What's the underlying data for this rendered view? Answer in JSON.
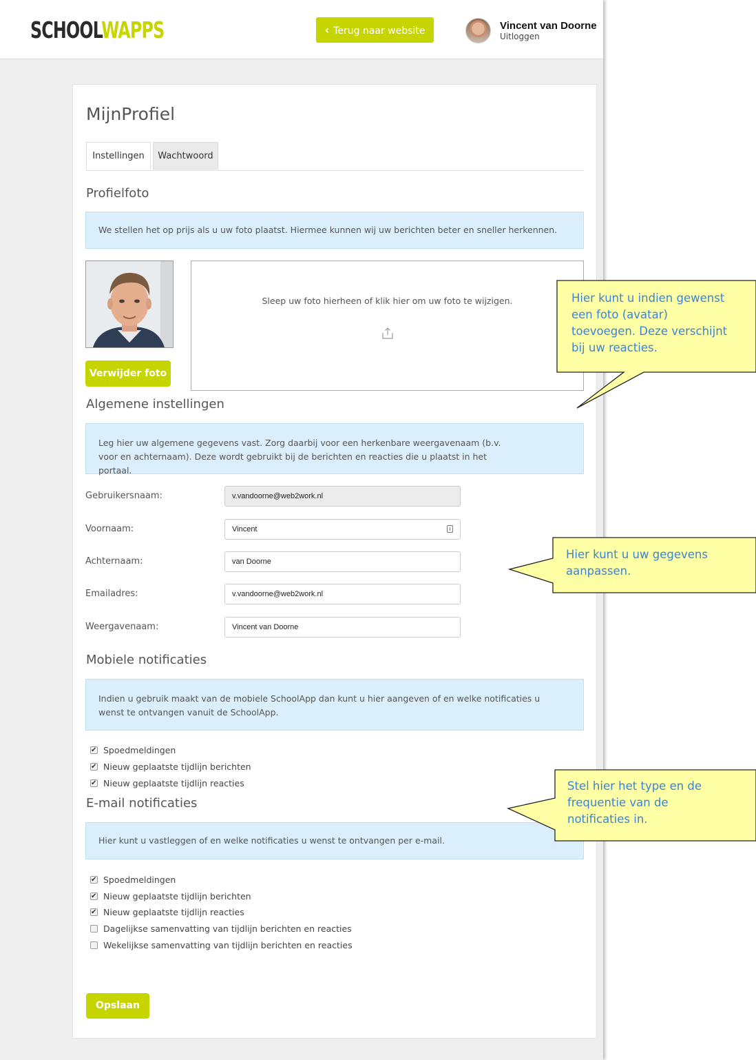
{
  "header": {
    "logo_part1": "SCHOOL",
    "logo_part2": "WAPPS",
    "back_button": "Terug naar website",
    "user_name": "Vincent van Doorne",
    "logout": "Uitloggen"
  },
  "page": {
    "title": "MijnProfiel",
    "tabs": [
      {
        "label": "Instellingen",
        "active": true
      },
      {
        "label": "Wachtwoord",
        "active": false
      }
    ]
  },
  "profile_photo": {
    "title": "Profielfoto",
    "info": "We stellen het op prijs als u uw foto plaatst. Hiermee kunnen wij uw berichten beter en sneller herkennen.",
    "drop_text": "Sleep uw foto hierheen of klik hier om uw foto te wijzigen.",
    "delete_button": "Verwijder foto"
  },
  "general": {
    "title": "Algemene instellingen",
    "info": "Leg hier uw algemene gegevens vast. Zorg daarbij voor een herkenbare weergavenaam (b.v. voor en achternaam). Deze wordt gebruikt bij de berichten en reacties die u plaatst in het portaal.",
    "fields": [
      {
        "label": "Gebruikersnaam:",
        "value": "v.vandoorne@web2work.nl",
        "disabled": true
      },
      {
        "label": "Voornaam:",
        "value": "Vincent"
      },
      {
        "label": "Achternaam:",
        "value": "van Doorne"
      },
      {
        "label": "Emailadres:",
        "value": "v.vandoorne@web2work.nl"
      },
      {
        "label": "Weergavenaam:",
        "value": "Vincent van Doorne"
      }
    ]
  },
  "mobile": {
    "title": "Mobiele notificaties",
    "info": "Indien u gebruik maakt van de mobiele SchoolApp dan kunt u hier aangeven of en welke notificaties u wenst te ontvangen vanuit de SchoolApp.",
    "options": [
      {
        "label": "Spoedmeldingen",
        "checked": true
      },
      {
        "label": "Nieuw geplaatste tijdlijn berichten",
        "checked": true
      },
      {
        "label": "Nieuw geplaatste tijdlijn reacties",
        "checked": true
      }
    ]
  },
  "email": {
    "title": "E-mail notificaties",
    "info": "Hier kunt u vastleggen of en welke notificaties u wenst te ontvangen per e-mail.",
    "options": [
      {
        "label": "Spoedmeldingen",
        "checked": true
      },
      {
        "label": "Nieuw geplaatste tijdlijn berichten",
        "checked": true
      },
      {
        "label": "Nieuw geplaatste tijdlijn reacties",
        "checked": true
      },
      {
        "label": "Dagelijkse samenvatting van tijdlijn berichten en reacties",
        "checked": false
      },
      {
        "label": "Wekelijkse samenvatting van tijdlijn berichten en reacties",
        "checked": false
      }
    ]
  },
  "save_button": "Opslaan",
  "callouts": [
    {
      "lines": [
        "Hier kunt u indien gewenst",
        "een foto (avatar)",
        "toevoegen. Deze verschijnt",
        "bij uw reacties."
      ]
    },
    {
      "lines": [
        "Hier kunt u uw gegevens",
        "aanpassen."
      ]
    },
    {
      "lines": [
        "Stel hier het type en de",
        "frequentie van de",
        "notificaties in."
      ]
    }
  ],
  "colors": {
    "accent": "#c6d400",
    "info_bg": "#dbeefc",
    "callout_bg": "#ffffa6",
    "callout_text": "#3a84d2"
  }
}
